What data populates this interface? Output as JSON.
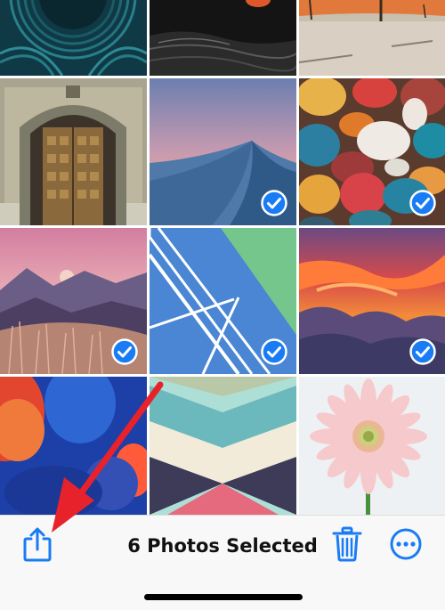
{
  "colors": {
    "accent": "#1a7cf5",
    "annotation_arrow": "#e8222a",
    "toolbar_bg": "#f8f8f8"
  },
  "photos": [
    {
      "subject": "abstract wavy lines",
      "selected": false
    },
    {
      "subject": "night sea",
      "selected": false
    },
    {
      "subject": "desert trees",
      "selected": false
    },
    {
      "subject": "ornate wooden door",
      "selected": false
    },
    {
      "subject": "sand dunes",
      "selected": true
    },
    {
      "subject": "colorful pebbles",
      "selected": true
    },
    {
      "subject": "pink mountain landscape",
      "selected": true
    },
    {
      "subject": "green blue geometric",
      "selected": true
    },
    {
      "subject": "sunset clouds",
      "selected": true
    },
    {
      "subject": "blue red gradient",
      "selected": false
    },
    {
      "subject": "pastel chevrons",
      "selected": false
    },
    {
      "subject": "pink gerbera flower",
      "selected": false
    }
  ],
  "toolbar": {
    "share_icon": "share-icon",
    "status_text": "6 Photos Selected",
    "trash_icon": "trash-icon",
    "more_icon": "more-icon"
  }
}
